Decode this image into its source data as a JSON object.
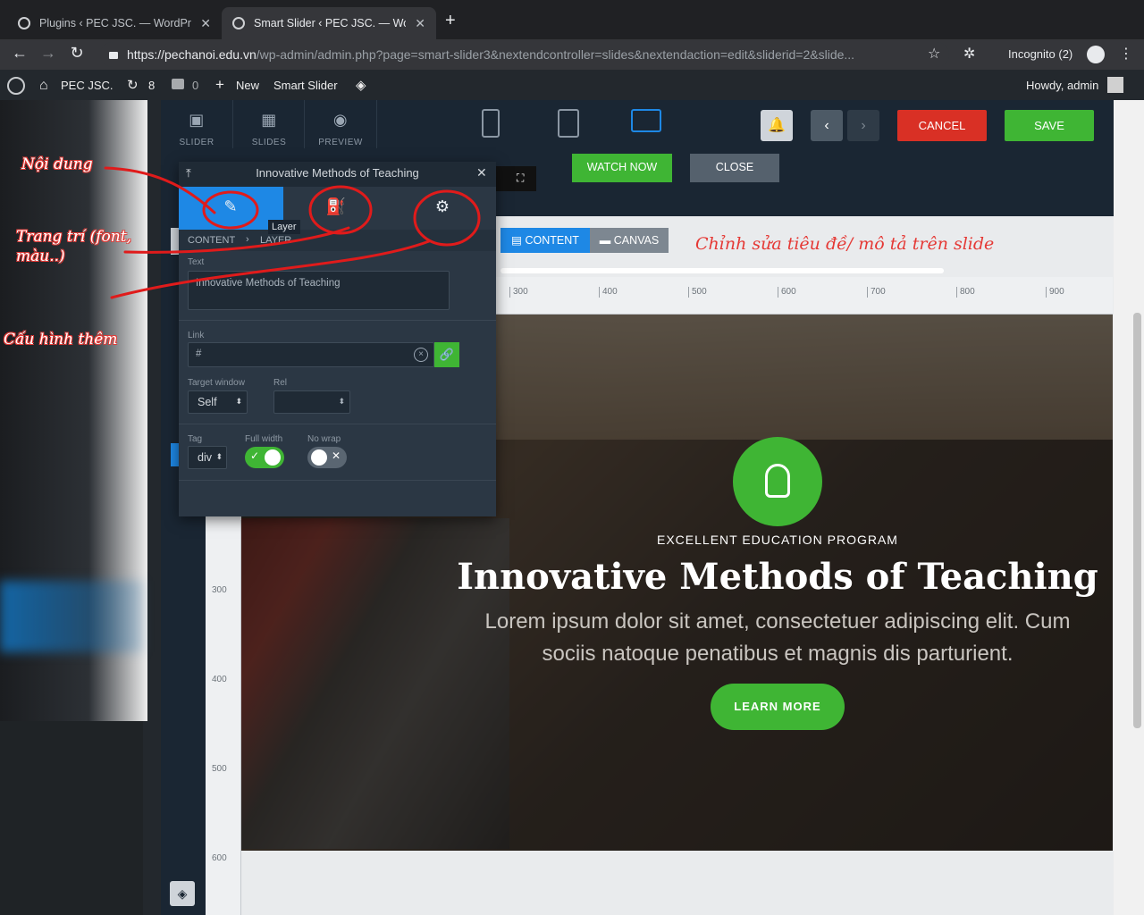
{
  "browser": {
    "tabs": [
      {
        "title": "Plugins ‹ PEC JSC. — WordPre"
      },
      {
        "title": "Smart Slider ‹ PEC JSC. — Wo"
      }
    ],
    "url_host": "https://pechanoi.edu.vn",
    "url_path": "/wp-admin/admin.php?page=smart-slider3&nextendcontroller=slides&nextendaction=edit&sliderid=2&slide...",
    "incognito": "Incognito (2)"
  },
  "wpbar": {
    "site": "PEC JSC.",
    "updates": "8",
    "comments": "0",
    "new": "New",
    "plugin": "Smart Slider",
    "howdy": "Howdy, admin"
  },
  "toolbar": {
    "slider": "SLIDER",
    "slides": "SLIDES",
    "preview": "PREVIEW",
    "cancel": "CANCEL",
    "save": "SAVE"
  },
  "buttons": {
    "watch_now": "WATCH NOW",
    "close": "CLOSE"
  },
  "modes": {
    "content": "CONTENT",
    "canvas": "CANVAS"
  },
  "ruler": {
    "h": [
      "300",
      "400",
      "500",
      "600",
      "700",
      "800",
      "900"
    ],
    "v": [
      "300",
      "400",
      "500",
      "600"
    ]
  },
  "layer_panel": {
    "title": "Innovative Methods of Teaching",
    "tooltip": "Layer",
    "crumb_root": "CONTENT",
    "crumb_leaf": "LAYER",
    "text_label": "Text",
    "text_value": "Innovative Methods of Teaching",
    "link_label": "Link",
    "link_value": "#",
    "target_label": "Target window",
    "target_value": "Self",
    "rel_label": "Rel",
    "tag_label": "Tag",
    "tag_value": "div",
    "fullwidth_label": "Full width",
    "nowrap_label": "No wrap"
  },
  "slide": {
    "eyebrow": "EXCELLENT EDUCATION PROGRAM",
    "headline": "Innovative Methods of Teaching",
    "body": "Lorem ipsum dolor sit amet, consectetuer adipiscing elit. Cum sociis natoque penatibus et magnis dis parturient.",
    "cta": "LEARN MORE"
  },
  "annotations": {
    "noi_dung": "Nội dung",
    "trang_tri": "Trang trí (font, màu..)",
    "cau_hinh": "Cấu hình thêm",
    "chinh_sua": "Chỉnh sửa tiêu đề/ mô tả trên slide"
  },
  "colors": {
    "accent": "#1e88e5",
    "green": "#3fb534",
    "red": "#d93025",
    "annotation": "#e53935"
  }
}
